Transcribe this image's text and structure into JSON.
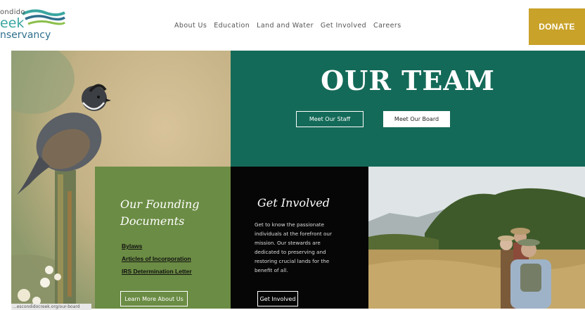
{
  "logo": {
    "line1": "ondido",
    "line2": "eek",
    "line3": "nservancy"
  },
  "nav": {
    "items": [
      "About Us",
      "Education",
      "Land and Water",
      "Get Involved",
      "Careers"
    ]
  },
  "donate_label": "DONATE",
  "team": {
    "title": "OUR TEAM",
    "staff_button": "Meet Our Staff",
    "board_button": "Meet Our Board"
  },
  "founding": {
    "title_line1": "Our Founding",
    "title_line2": "Documents",
    "links": [
      "Bylaws",
      "Articles of Incorporation",
      "IRS Determination Letter"
    ],
    "button": "Learn More About Us"
  },
  "involved": {
    "title": "Get Involved",
    "body": "Get to know the passionate individuals at the forefront our mission. Our stewards are dedicated to preserving and restoring crucial lands for the benefit of all.",
    "button": "Get Involved"
  },
  "status_bar": "...escondidocreek.org/our-board",
  "colors": {
    "team_green": "#146a58",
    "founding_green": "#6b8c44",
    "donate_gold": "#c9a22a"
  }
}
